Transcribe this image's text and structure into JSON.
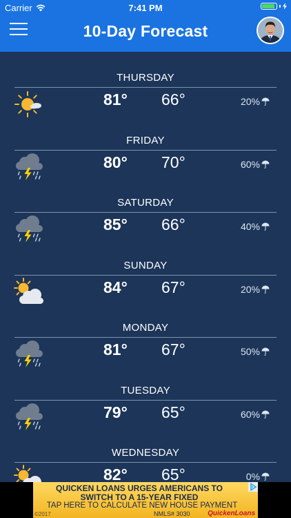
{
  "status_bar": {
    "carrier": "Carrier",
    "time": "7:41 PM",
    "wifi_icon": "wifi-icon",
    "battery_icon": "battery-icon",
    "battery_level": 0.9
  },
  "header": {
    "title": "10-Day Forecast",
    "menu_icon": "hamburger-menu-icon",
    "avatar": "profile-avatar"
  },
  "colors": {
    "header_bg": "#1a73e1",
    "page_bg": "#1c3559",
    "divider": "#7f93ad",
    "sun": "#f7b731",
    "bolt": "#ffd200"
  },
  "forecast": [
    {
      "day": "THURSDAY",
      "icon": "mostly-sunny-icon",
      "high": "81°",
      "low": "66°",
      "precip": "20%"
    },
    {
      "day": "FRIDAY",
      "icon": "thunderstorm-icon",
      "high": "80°",
      "low": "70°",
      "precip": "60%"
    },
    {
      "day": "SATURDAY",
      "icon": "thunderstorm-icon",
      "high": "85°",
      "low": "66°",
      "precip": "40%"
    },
    {
      "day": "SUNDAY",
      "icon": "partly-cloudy-icon",
      "high": "84°",
      "low": "67°",
      "precip": "20%"
    },
    {
      "day": "MONDAY",
      "icon": "thunderstorm-icon",
      "high": "81°",
      "low": "67°",
      "precip": "50%"
    },
    {
      "day": "TUESDAY",
      "icon": "thunderstorm-icon",
      "high": "79°",
      "low": "65°",
      "precip": "60%"
    },
    {
      "day": "WEDNESDAY",
      "icon": "partly-cloudy-icon",
      "high": "82°",
      "low": "65°",
      "precip": "0%"
    }
  ],
  "precip_icon": "umbrella-icon",
  "ad": {
    "line1": "QUICKEN LOANS URGES AMERICANS TO",
    "line2": "SWITCH TO A 15-YEAR FIXED",
    "line3": "TAP HERE TO CALCULATE NEW HOUSE PAYMENT",
    "copyright": "©2017",
    "nmls": "NMLS# 3030",
    "brand": "QuickenLoans",
    "choices_icon": "ad-choices-icon"
  }
}
